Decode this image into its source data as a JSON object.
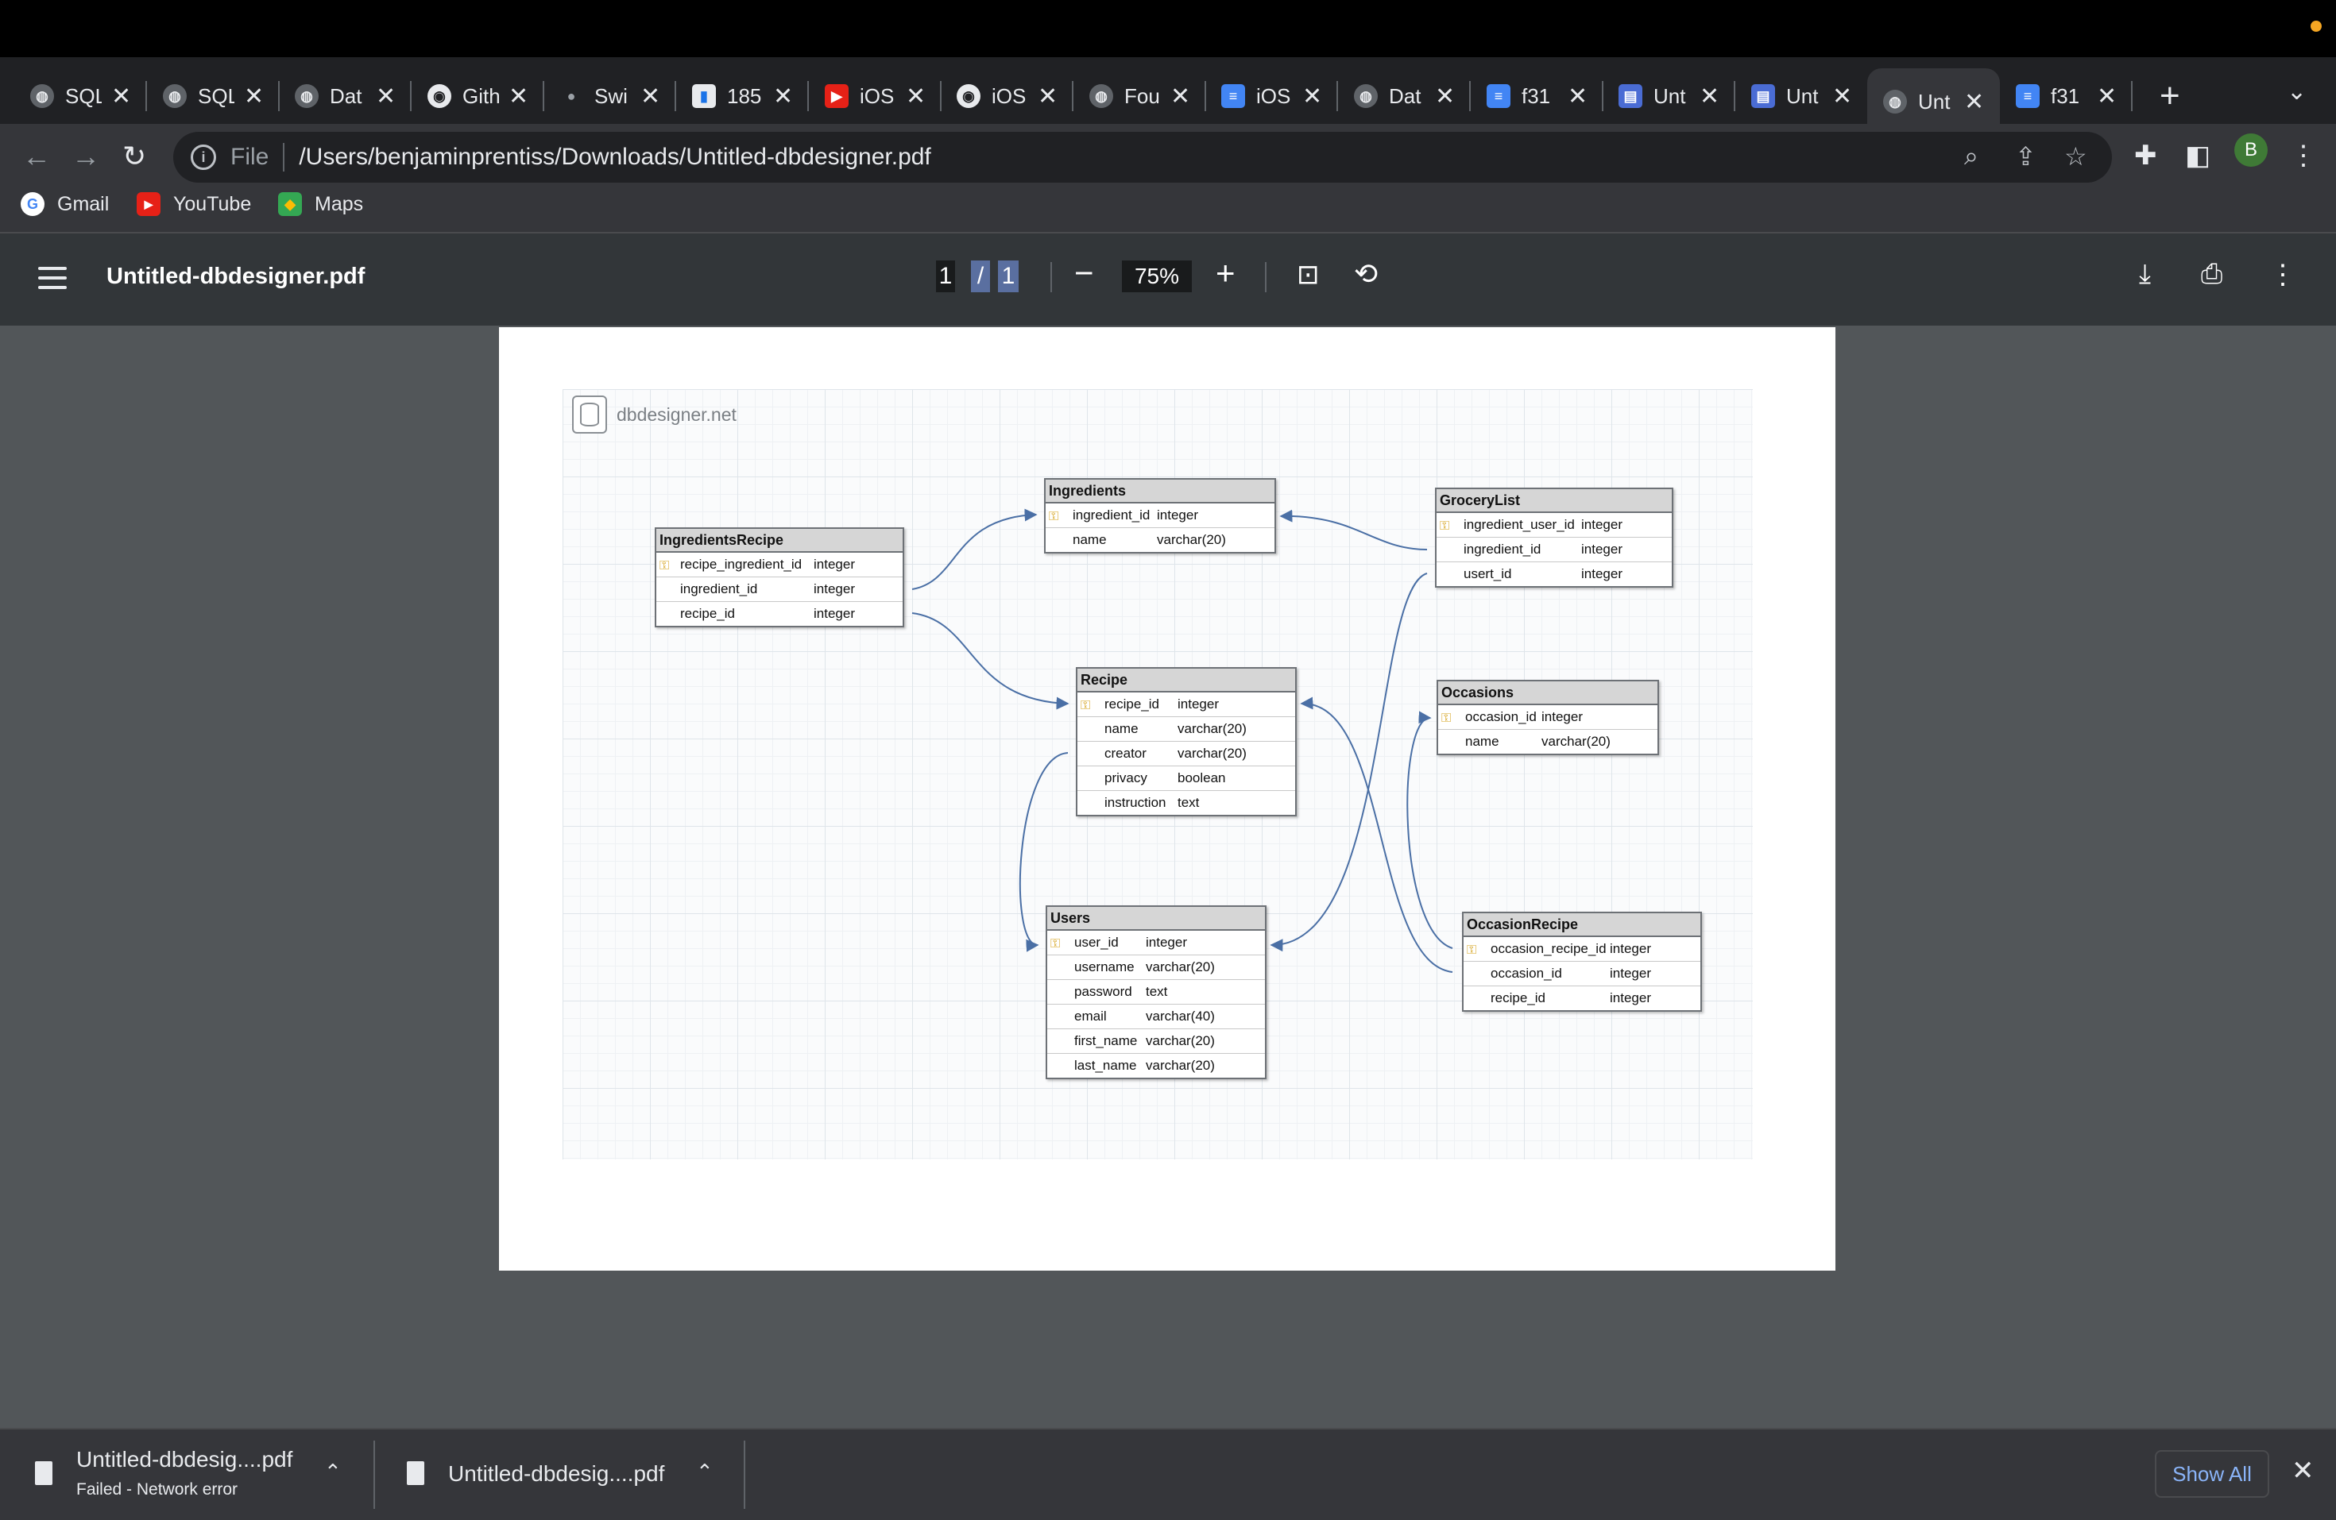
{
  "tabs": [
    {
      "title": "SQL",
      "icon": "globe-icon"
    },
    {
      "title": "SQL",
      "icon": "globe-icon"
    },
    {
      "title": "Dat",
      "icon": "globe-icon"
    },
    {
      "title": "Gith",
      "icon": "github-icon"
    },
    {
      "title": "Swi",
      "icon": "apple-icon"
    },
    {
      "title": "185",
      "icon": "book-icon"
    },
    {
      "title": "iOS",
      "icon": "youtube-icon"
    },
    {
      "title": "iOS",
      "icon": "github-icon"
    },
    {
      "title": "Fou",
      "icon": "globe-icon"
    },
    {
      "title": "iOS",
      "icon": "docs-icon"
    },
    {
      "title": "Dat",
      "icon": "globe-icon"
    },
    {
      "title": "f31",
      "icon": "docs-icon"
    },
    {
      "title": "Unt",
      "icon": "db-icon"
    },
    {
      "title": "Unt",
      "icon": "db-icon"
    },
    {
      "title": "Unt",
      "icon": "globe-icon"
    },
    {
      "title": "f31",
      "icon": "docs-icon"
    }
  ],
  "address_bar": {
    "scheme": "File",
    "url": "/Users/benjaminprentiss/Downloads/Untitled-dbdesigner.pdf"
  },
  "profile_initial": "B",
  "bookmarks": [
    {
      "label": "Gmail",
      "icon": "google-icon"
    },
    {
      "label": "YouTube",
      "icon": "youtube-icon"
    },
    {
      "label": "Maps",
      "icon": "maps-icon"
    }
  ],
  "pdf": {
    "filename": "Untitled-dbdesigner.pdf",
    "current_page": "1",
    "page_sep": "/",
    "total_pages": "1",
    "zoom": "75%"
  },
  "diagram": {
    "brand": "dbdesigner.net",
    "tables": {
      "ingredients_recipe": {
        "name": "IngredientsRecipe",
        "columns": [
          {
            "name": "recipe_ingredient_id",
            "type": "integer",
            "pk": true
          },
          {
            "name": "ingredient_id",
            "type": "integer",
            "pk": false
          },
          {
            "name": "recipe_id",
            "type": "integer",
            "pk": false
          }
        ]
      },
      "ingredients": {
        "name": "Ingredients",
        "columns": [
          {
            "name": "ingredient_id",
            "type": "integer",
            "pk": true
          },
          {
            "name": "name",
            "type": "varchar(20)",
            "pk": false
          }
        ]
      },
      "grocery_list": {
        "name": "GroceryList",
        "columns": [
          {
            "name": "ingredient_user_id",
            "type": "integer",
            "pk": true
          },
          {
            "name": "ingredient_id",
            "type": "integer",
            "pk": false
          },
          {
            "name": "usert_id",
            "type": "integer",
            "pk": false
          }
        ]
      },
      "recipe": {
        "name": "Recipe",
        "columns": [
          {
            "name": "recipe_id",
            "type": "integer",
            "pk": true
          },
          {
            "name": "name",
            "type": "varchar(20)",
            "pk": false
          },
          {
            "name": "creator",
            "type": "varchar(20)",
            "pk": false
          },
          {
            "name": "privacy",
            "type": "boolean",
            "pk": false
          },
          {
            "name": "instruction",
            "type": "text",
            "pk": false
          }
        ]
      },
      "occasions": {
        "name": "Occasions",
        "columns": [
          {
            "name": "occasion_id",
            "type": "integer",
            "pk": true
          },
          {
            "name": "name",
            "type": "varchar(20)",
            "pk": false
          }
        ]
      },
      "users": {
        "name": "Users",
        "columns": [
          {
            "name": "user_id",
            "type": "integer",
            "pk": true
          },
          {
            "name": "username",
            "type": "varchar(20)",
            "pk": false
          },
          {
            "name": "password",
            "type": "text",
            "pk": false
          },
          {
            "name": "email",
            "type": "varchar(40)",
            "pk": false
          },
          {
            "name": "first_name",
            "type": "varchar(20)",
            "pk": false
          },
          {
            "name": "last_name",
            "type": "varchar(20)",
            "pk": false
          }
        ]
      },
      "occasion_recipe": {
        "name": "OccasionRecipe",
        "columns": [
          {
            "name": "occasion_recipe_id",
            "type": "integer",
            "pk": true
          },
          {
            "name": "occasion_id",
            "type": "integer",
            "pk": false
          },
          {
            "name": "recipe_id",
            "type": "integer",
            "pk": false
          }
        ]
      }
    }
  },
  "downloads": [
    {
      "name": "Untitled-dbdesig....pdf",
      "status": "Failed - Network error"
    },
    {
      "name": "Untitled-dbdesig....pdf",
      "status": ""
    }
  ],
  "show_all_label": "Show All",
  "colors": {
    "connector": "#4a6fa5",
    "pk_key": "#d4a017",
    "accent": "#8ab4f8"
  }
}
